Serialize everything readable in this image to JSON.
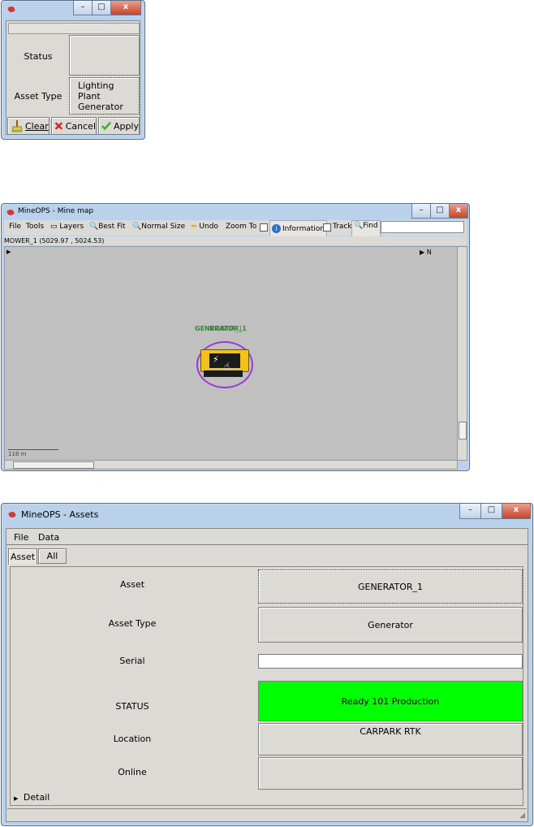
{
  "filter_dialog": {
    "fields": [
      {
        "label": "Status",
        "value": ""
      },
      {
        "label": "Asset Type",
        "value": "Lighting Plant\nGenerator"
      }
    ],
    "buttons": [
      {
        "label": "Clear",
        "icon": "broom-icon"
      },
      {
        "label": "Cancel",
        "icon": "red-x-icon"
      },
      {
        "label": "Apply",
        "icon": "green-check-icon"
      }
    ]
  },
  "mine_map": {
    "title": "MineOPS - Mine map",
    "toolbar": {
      "file": "File",
      "tools": "Tools",
      "layers": "Layers",
      "best_fit": "Best Fit",
      "normal_size": "Normal Size",
      "undo": "Undo",
      "zoom_to": "Zoom To",
      "information": "Information",
      "track": "Track",
      "find": "Find",
      "find_value": ""
    },
    "coordinates": "MOWER_1 (5029.97 , 5024.53)",
    "north_label": "N",
    "asset_label": "GENERATOR_1",
    "asset_label_overlay": "MOWER_1",
    "scale": "116 m"
  },
  "assets_window": {
    "title": "MineOPS - Assets",
    "menu": [
      "File",
      "Data"
    ],
    "tabs": [
      {
        "label": "Asset",
        "active": true
      },
      {
        "label": "All",
        "active": false
      }
    ],
    "fields": {
      "asset": {
        "label": "Asset",
        "value": "GENERATOR_1"
      },
      "asset_type": {
        "label": "Asset Type",
        "value": "Generator"
      },
      "serial": {
        "label": "Serial",
        "value": ""
      },
      "status": {
        "label": "STATUS",
        "value": "Ready 101 Production",
        "color": "#00ff00"
      },
      "location": {
        "label": "Location",
        "value": "CARPARK RTK"
      },
      "online": {
        "label": "Online",
        "value": ""
      }
    },
    "detail_label": "Detail"
  },
  "colors": {
    "title_bar": "#b9d1ea",
    "panel": "#dcdad5",
    "map_bg": "#c0c0c0",
    "status_green": "#00ff00",
    "asset_circle": "#9a3ad1",
    "asset_yellow": "#f2c21b"
  }
}
